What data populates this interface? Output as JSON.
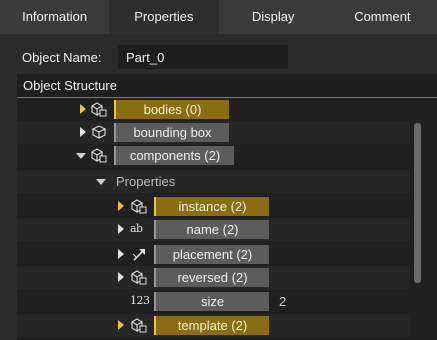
{
  "tabs": [
    {
      "label": "Information"
    },
    {
      "label": "Properties",
      "active": true
    },
    {
      "label": "Display"
    },
    {
      "label": "Comment"
    }
  ],
  "object_name": {
    "label": "Object Name:",
    "value": "Part_0"
  },
  "structure": {
    "header": "Object Structure",
    "rows": [
      {
        "label": "bodies (0)",
        "icon": "node-set-icon",
        "expander": "collapsed",
        "highlight": "gold"
      },
      {
        "label": "bounding box",
        "icon": "box-icon",
        "expander": "collapsed",
        "highlight": "gray"
      },
      {
        "label": "components (2)",
        "icon": "node-set-icon",
        "expander": "expanded",
        "highlight": "gray"
      },
      {
        "label": "Properties",
        "expander": "expanded",
        "group": true
      },
      {
        "label": "instance (2)",
        "icon": "node-set-icon",
        "expander": "collapsed",
        "highlight": "gold"
      },
      {
        "label": "name (2)",
        "icon": "text-icon",
        "icon_text": "ab",
        "expander": "collapsed",
        "highlight": "gray"
      },
      {
        "label": "placement (2)",
        "icon": "placement-arrow-icon",
        "expander": "collapsed",
        "highlight": "gray"
      },
      {
        "label": "reversed (2)",
        "icon": "node-set-icon",
        "expander": "collapsed",
        "highlight": "gray"
      },
      {
        "label": "size",
        "icon": "number-icon",
        "icon_text": "123",
        "highlight": "gray",
        "value": "2"
      },
      {
        "label": "template (2)",
        "icon": "node-set-icon",
        "expander": "collapsed",
        "highlight": "gold"
      }
    ]
  },
  "colors": {
    "accent": "#2f8fd0",
    "gold_highlight": "#8a6d10",
    "gold_arrow": "#f0c040",
    "gray_pill": "#5c5c5c"
  }
}
